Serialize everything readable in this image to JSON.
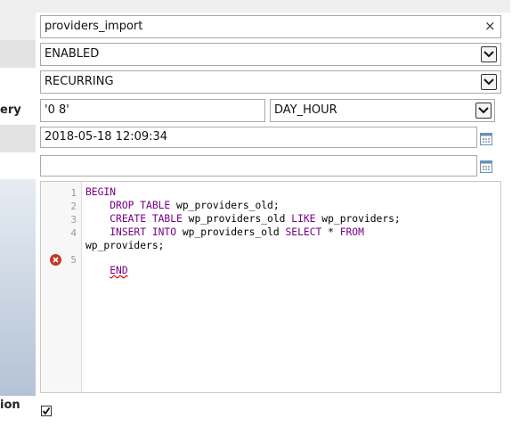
{
  "colors": {
    "band": "#efefef",
    "band_alt": "#e3e3e3",
    "sidebar_grad_top": "#e7ecf2",
    "sidebar_grad_bottom": "#b3c3d6",
    "keyword": "#770088"
  },
  "form": {
    "event_name": {
      "value": "providers_import",
      "clear_glyph": "×"
    },
    "status": {
      "value": "ENABLED"
    },
    "event_type": {
      "value": "RECURRING"
    },
    "execute_every": {
      "label_fragment": "ery",
      "interval_value": "'0 8'",
      "interval_unit": "DAY_HOUR"
    },
    "start": {
      "value": "2018-05-18 12:09:34"
    },
    "end": {
      "value": ""
    },
    "definition": {
      "line_numbers": [
        "1",
        "2",
        "3",
        "4",
        "5"
      ],
      "lines": {
        "l1_kw": "BEGIN",
        "l2_kw1": "DROP TABLE",
        "l2_rest": " wp_providers_old;",
        "l3_kw1": "CREATE TABLE",
        "l3_mid": " wp_providers_old ",
        "l3_kw2": "LIKE",
        "l3_rest": " wp_providers;",
        "l4_kw1": "INSERT INTO",
        "l4_mid": " wp_providers_old ",
        "l4_kw2": "SELECT",
        "l4_mid2": " * ",
        "l4_kw3": "FROM",
        "l4_wrap": "wp_providers;",
        "l5_kw": "END"
      }
    },
    "on_completion": {
      "label_fragment": "ion",
      "checked": true,
      "check_glyph": "✓"
    }
  }
}
